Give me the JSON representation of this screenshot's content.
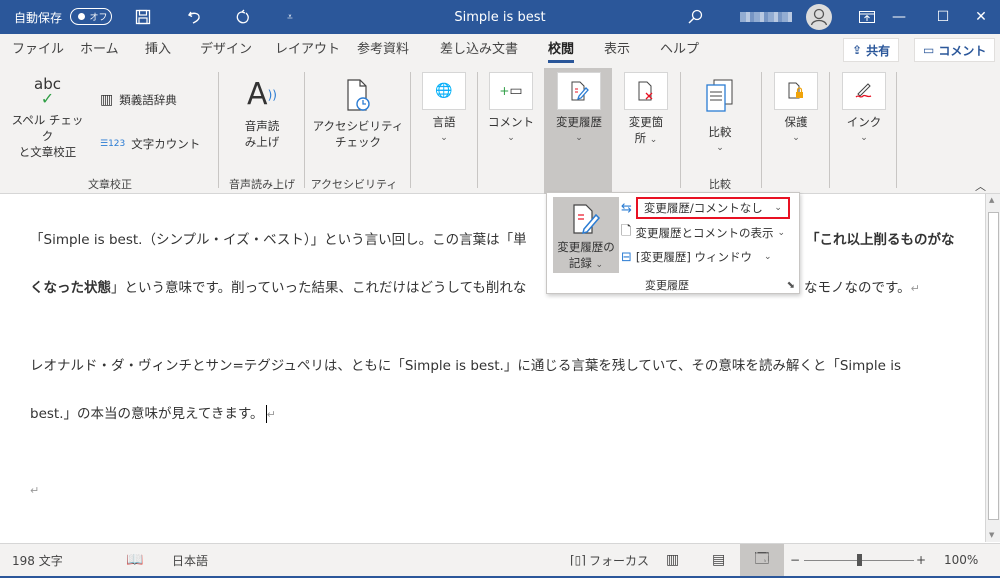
{
  "titlebar": {
    "autosave_label": "自動保存",
    "autosave_state": "オフ",
    "doc_title": "Simple is best",
    "save_icon": "save-icon",
    "undo_icon": "undo-icon",
    "redo_icon": "redo-icon",
    "customize_icon": "customize-qat-icon",
    "search_icon": "search-icon",
    "minimize": "—",
    "maximize": "☐",
    "close": "✕"
  },
  "tabs": [
    {
      "label": "ファイル"
    },
    {
      "label": "ホーム"
    },
    {
      "label": "挿入"
    },
    {
      "label": "デザイン"
    },
    {
      "label": "レイアウト"
    },
    {
      "label": "参考資料"
    },
    {
      "label": "差し込み文書"
    },
    {
      "label": "校閲",
      "active": true
    },
    {
      "label": "表示"
    },
    {
      "label": "ヘルプ"
    }
  ],
  "share_label": "共有",
  "comment_label": "コメント",
  "ribbon": {
    "spellcheck": {
      "line1": "スペル チェック",
      "line2": "と文章校正",
      "icon_text": "abc"
    },
    "thesaurus": "類義語辞典",
    "wordcount": "文字カウント",
    "group_proofing": "文章校正",
    "readaloud": {
      "line1": "音声読",
      "line2": "み上げ"
    },
    "group_speech": "音声読み上げ",
    "accessibility": {
      "line1": "アクセシビリティ",
      "line2": "チェック"
    },
    "group_accessibility": "アクセシビリティ",
    "language": "言語",
    "comment": "コメント",
    "tracking": "変更履歴",
    "changes": {
      "line1": "変更箇",
      "line2": "所"
    },
    "compare": "比較",
    "group_compare": "比較",
    "protect": "保護",
    "ink": "インク"
  },
  "tracking_popup": {
    "record_line1": "変更履歴の",
    "record_line2": "記録",
    "display_dropdown": "変更履歴/コメントなし",
    "show_markup": "変更履歴とコメントの表示",
    "reviewing_pane": "[変更履歴] ウィンドウ",
    "group_label": "変更履歴"
  },
  "document": {
    "p1_line1_a": "「Simple is best.（シンプル・イズ・ベスト）」という言い回し。この言葉は「単",
    "p1_line1_b": "「これ以上削るものがな",
    "p1_line2_a": "くなった状態",
    "p1_line2_b": "」という意味です。削っていった結果、これだけはどうしても削れな",
    "p1_line2_c": "なモノなのです。",
    "p2_line1": "レオナルド・ダ・ヴィンチとサン=テグジュペリは、ともに「Simple is best.」に通じる言葉を残していて、その意味を読み解くと「Simple is",
    "p2_line2": "best.」の本当の意味が見えてきます。",
    "para_mark": "↵"
  },
  "statusbar": {
    "word_count": "198 文字",
    "language": "日本語",
    "focus": "フォーカス",
    "zoom_minus": "−",
    "zoom_plus": "+",
    "zoom_level": "100%",
    "zoom_value_percent": 100
  }
}
